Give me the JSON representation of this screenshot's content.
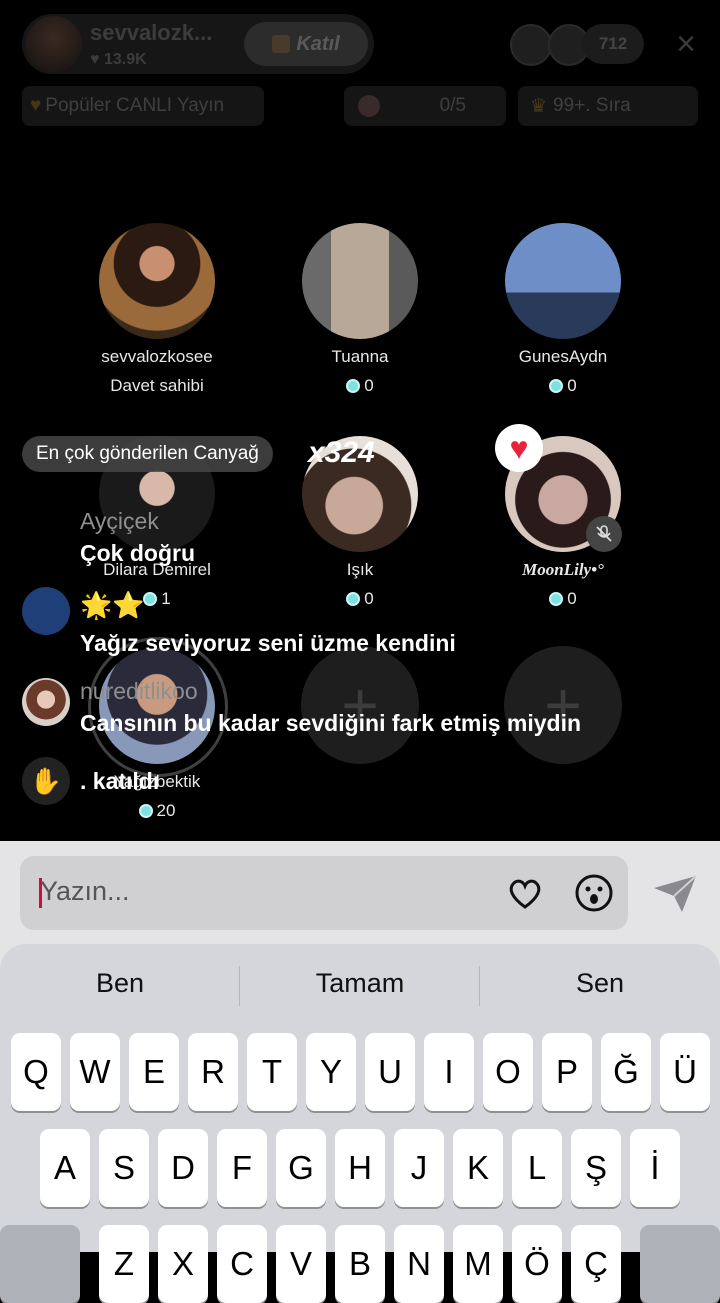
{
  "header": {
    "host_name": "sevvalozk...",
    "host_likes": "13.9K",
    "join_label": "Katıl",
    "viewer_count": "712",
    "close_icon": "×"
  },
  "chips": {
    "popular_label": "Popüler CANLI Yayın",
    "goal_progress": "0/5",
    "rank_label": "99+. Sıra"
  },
  "seats": [
    {
      "name": "sevvalozkosee",
      "sub": "Davet sahibi"
    },
    {
      "name": "Tuanna",
      "coins": "0"
    },
    {
      "name": "GunesAydn",
      "coins": "0"
    },
    {
      "name": "Dilara Demirel",
      "coins": "1"
    },
    {
      "name": "Işık",
      "coins": "0"
    },
    {
      "name": "MoonLily•°",
      "coins": "0"
    },
    {
      "name": "Yağızbektik",
      "coins": "20"
    }
  ],
  "gift": {
    "banner": "En çok gönderilen Canyağ",
    "count": "x324"
  },
  "chat": [
    {
      "user": "Ayçiçek",
      "message": "Çok doğru"
    },
    {
      "user": "",
      "message": "🌟⭐"
    },
    {
      "user": "",
      "message": "Yağız seviyoruz seni üzme kendini"
    },
    {
      "user": "nureditlikoo",
      "message": "Cansının bu kadar sevdiğini fark etmiş miydin"
    },
    {
      "user": ".",
      "message": "katıldı"
    }
  ],
  "input": {
    "placeholder": "Yazın..."
  },
  "keyboard": {
    "suggestions": [
      "Ben",
      "Tamam",
      "Sen"
    ],
    "row1": [
      "Q",
      "W",
      "E",
      "R",
      "T",
      "Y",
      "U",
      "I",
      "O",
      "P",
      "Ğ",
      "Ü"
    ],
    "row2": [
      "A",
      "S",
      "D",
      "F",
      "G",
      "H",
      "J",
      "K",
      "L",
      "Ş",
      "İ"
    ],
    "row3": [
      "Z",
      "X",
      "C",
      "V",
      "B",
      "N",
      "M",
      "Ö",
      "Ç"
    ]
  },
  "colors": {
    "background": "#000000",
    "coin": "#7fe0e0",
    "heart": "#e8223a",
    "caret": "#c81040"
  }
}
